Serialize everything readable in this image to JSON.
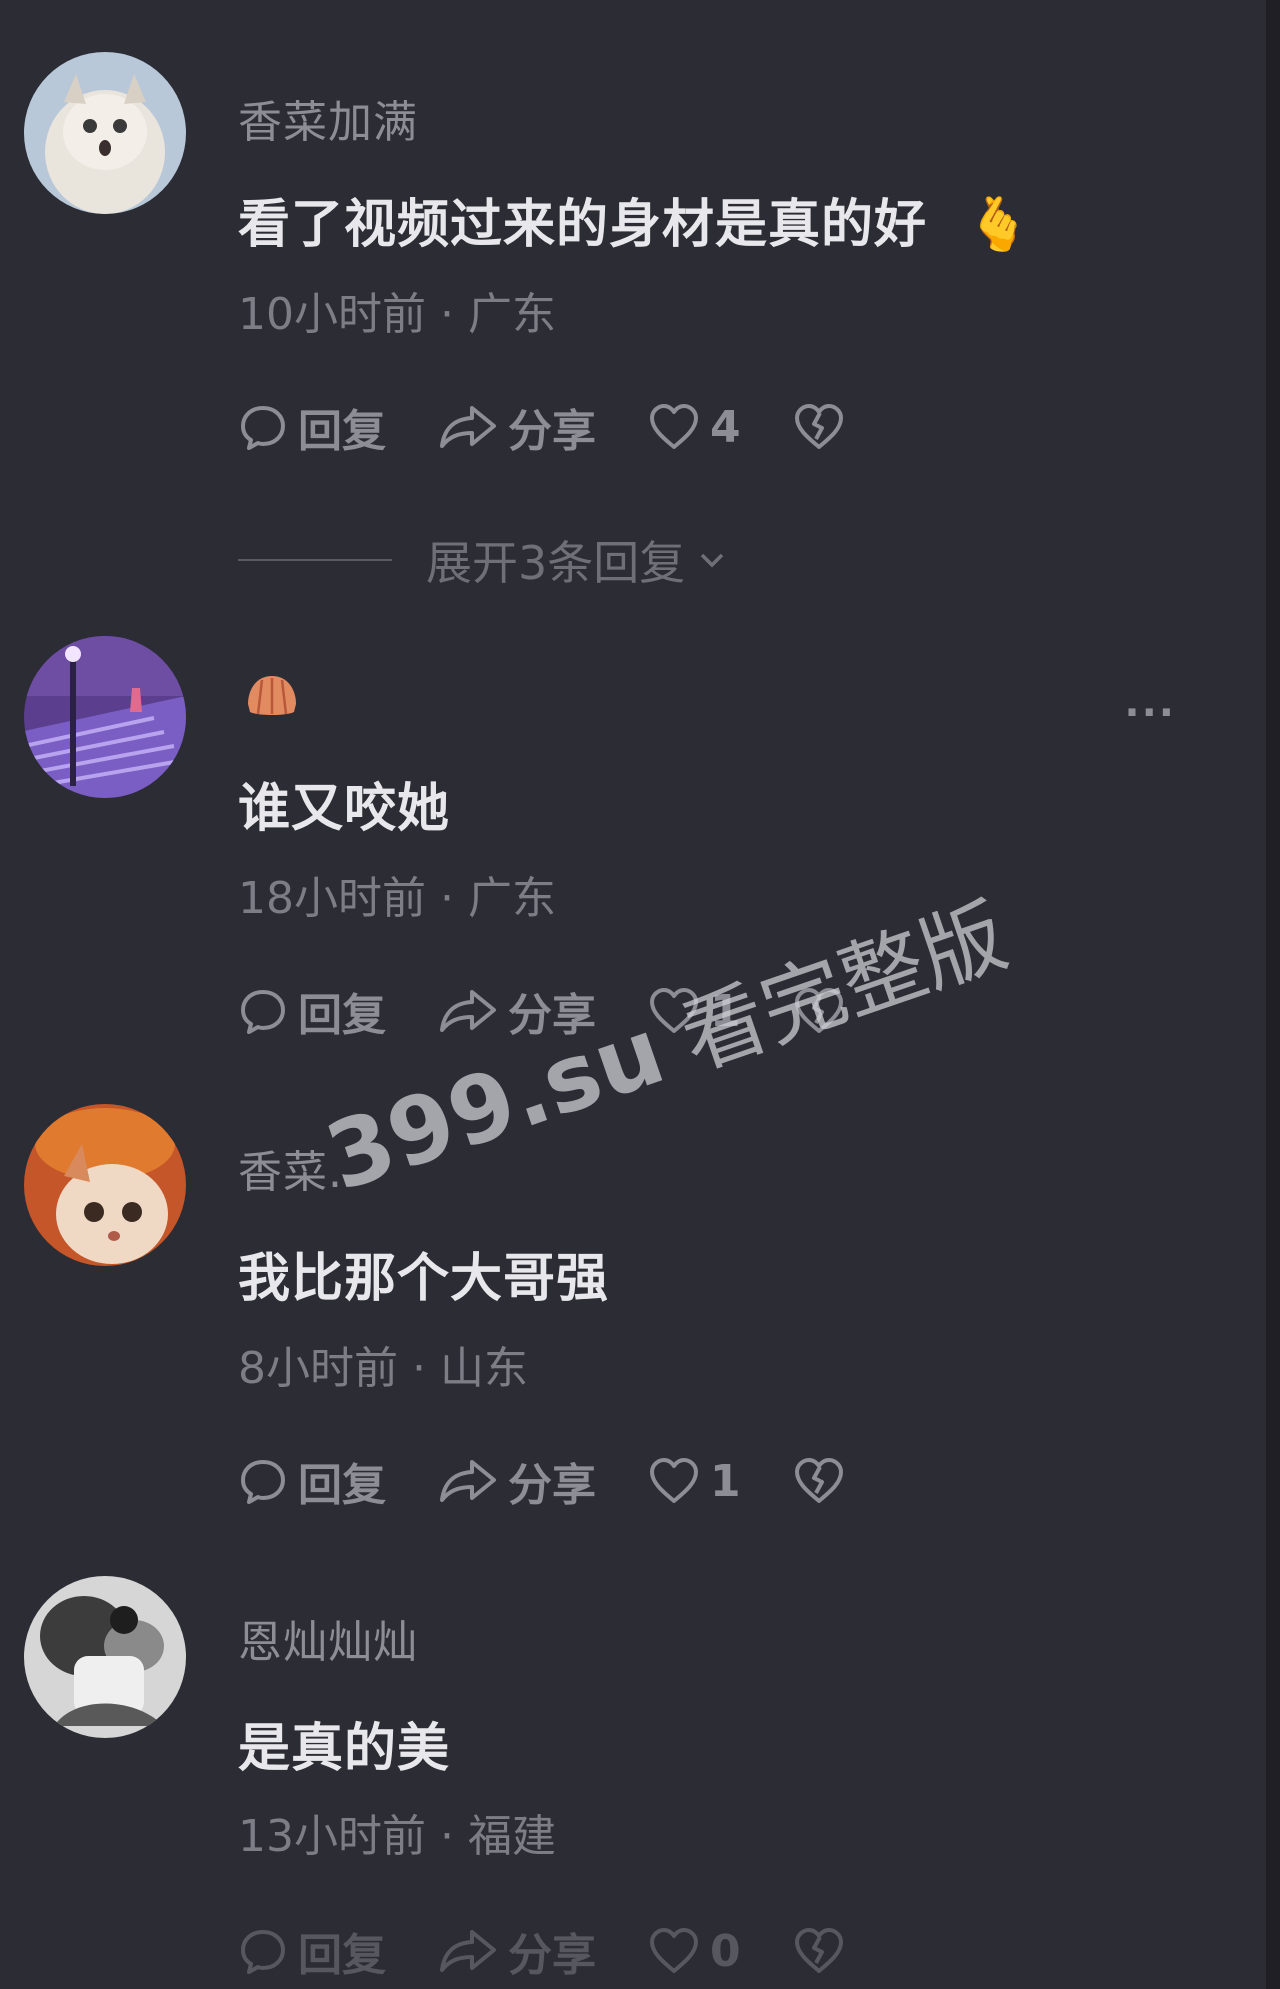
{
  "comments": [
    {
      "username": "香菜加满",
      "text": "看了视频过来的身材是真的好",
      "text_emoji": "🫰",
      "time": "10小时前",
      "location": "广东",
      "reply_label": "回复",
      "share_label": "分享",
      "likes": "4",
      "expand_replies": "展开3条回复"
    },
    {
      "username": "",
      "text": "谁又咬她",
      "time": "18小时前",
      "location": "广东",
      "reply_label": "回复",
      "share_label": "分享",
      "likes": "1",
      "more_label": "···"
    },
    {
      "username": "香菜.",
      "text": "我比那个大哥强",
      "time": "8小时前",
      "location": "山东",
      "reply_label": "回复",
      "share_label": "分享",
      "likes": "1"
    },
    {
      "username": "恩灿灿灿",
      "text": "是真的美",
      "time": "13小时前",
      "location": "福建",
      "reply_label": "回复",
      "share_label": "分享",
      "likes": "0"
    }
  ],
  "meta_separator": " · ",
  "watermark": {
    "domain": "399.su",
    "text": "看完整版"
  },
  "colors": {
    "background": "#2c2c34",
    "text": "#e8e8ec",
    "muted": "#8d8d95"
  }
}
